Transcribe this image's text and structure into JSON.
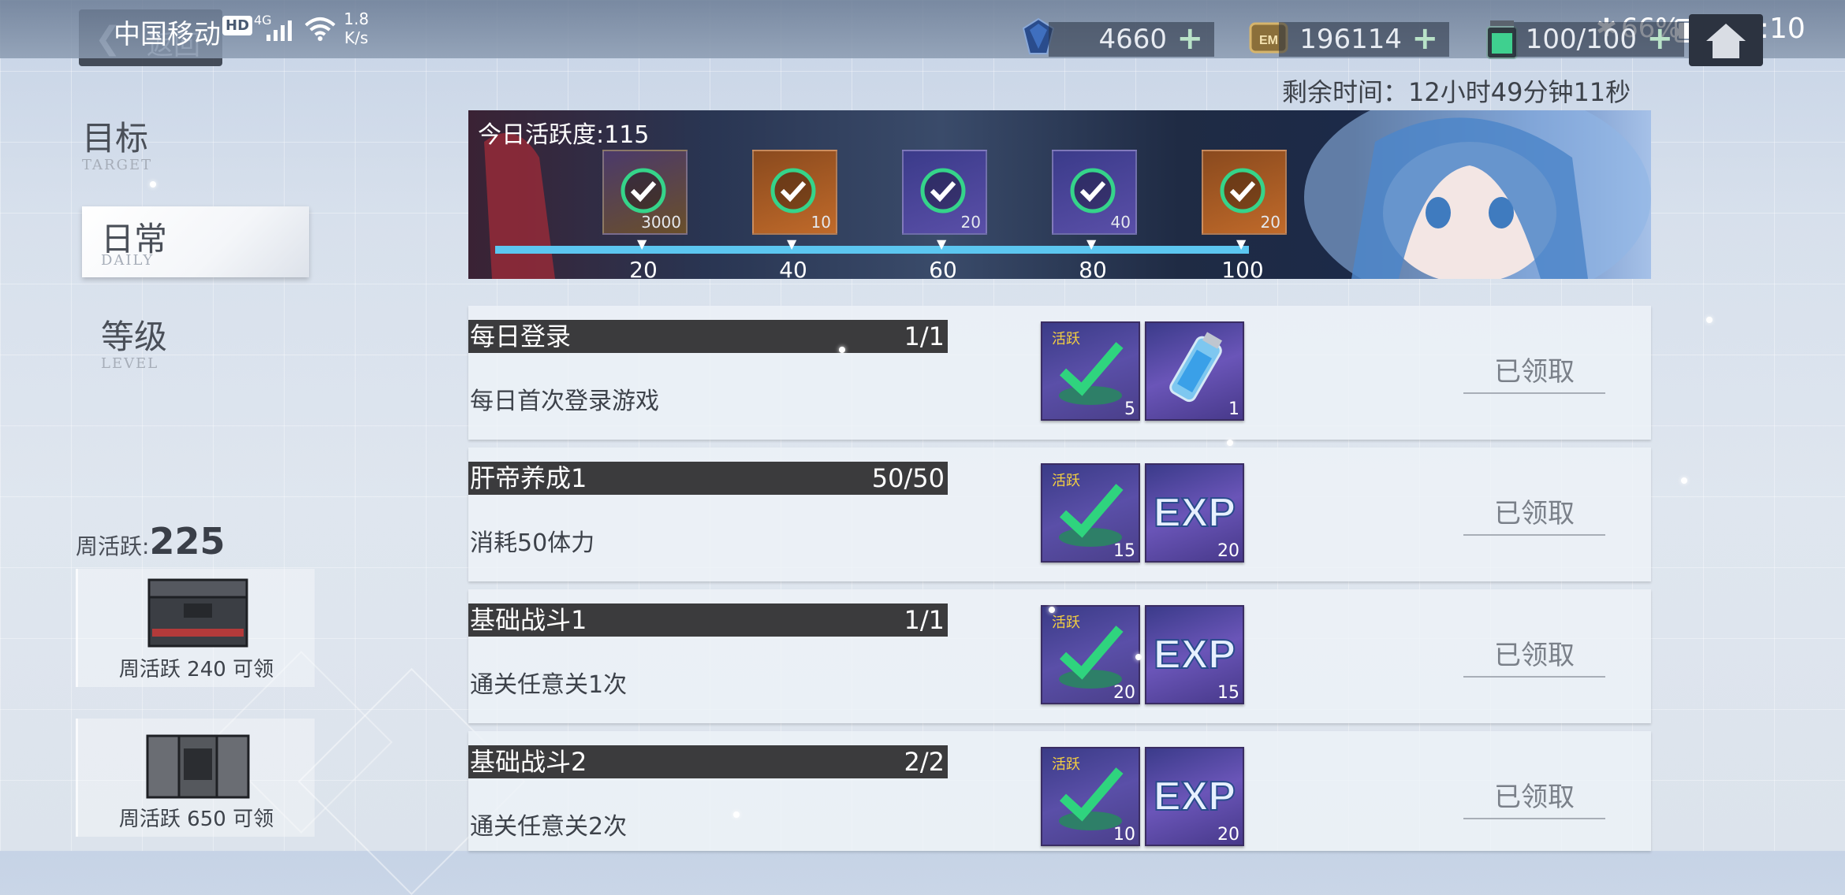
{
  "status_bar": {
    "carrier": "中国移动",
    "hd": "HD",
    "network": "4G",
    "speed_value": "1.8",
    "speed_unit": "K/s",
    "battery": "66%",
    "time": "16:10"
  },
  "header": {
    "back_label": "返回",
    "currencies": [
      {
        "icon": "diamond-icon",
        "value": "4660"
      },
      {
        "icon": "em-coin-icon",
        "value": "196114"
      },
      {
        "icon": "energy-battery-icon",
        "value": "100/100"
      }
    ]
  },
  "timer": "剩余时间：12小时49分钟11秒",
  "nav": {
    "items": [
      {
        "cn": "目标",
        "en": "TARGET"
      },
      {
        "cn": "日常",
        "en": "DAILY"
      },
      {
        "cn": "等级",
        "en": "LEVEL"
      }
    ]
  },
  "weekly": {
    "label": "周活跃:",
    "value": "225",
    "chests": [
      {
        "caption": "周活跃 240 可领"
      },
      {
        "caption": "周活跃 650 可领"
      }
    ]
  },
  "banner": {
    "title": "今日活跃度:115",
    "progress_fraction": 1.0,
    "milestones": [
      {
        "count": "3000",
        "tick": "20",
        "icon": "coin-crate-icon"
      },
      {
        "count": "10",
        "tick": "40",
        "icon": "gift-box-icon"
      },
      {
        "count": "20",
        "tick": "60",
        "icon": "canister-icon"
      },
      {
        "count": "40",
        "tick": "80",
        "icon": "canister-icon"
      },
      {
        "count": "20",
        "tick": "100",
        "icon": "gem-crate-icon"
      }
    ]
  },
  "tasks": [
    {
      "name": "每日登录",
      "progress": "1/1",
      "desc": "每日首次登录游戏",
      "rewards": [
        {
          "icon": "activity-icon",
          "count": "5"
        },
        {
          "icon": "energy-canister-icon",
          "count": "1"
        }
      ],
      "status": "已领取"
    },
    {
      "name": "肝帝养成1",
      "progress": "50/50",
      "desc": "消耗50体力",
      "rewards": [
        {
          "icon": "activity-icon",
          "count": "15"
        },
        {
          "icon": "exp-icon",
          "count": "20"
        }
      ],
      "status": "已领取"
    },
    {
      "name": "基础战斗1",
      "progress": "1/1",
      "desc": "通关任意关1次",
      "rewards": [
        {
          "icon": "activity-icon",
          "count": "20"
        },
        {
          "icon": "exp-icon",
          "count": "15"
        }
      ],
      "status": "已领取"
    },
    {
      "name": "基础战斗2",
      "progress": "2/2",
      "desc": "通关任意关2次",
      "rewards": [
        {
          "icon": "activity-icon",
          "count": "10"
        },
        {
          "icon": "exp-icon",
          "count": "20"
        }
      ],
      "status": "已领取"
    }
  ],
  "reward_label": "活跃",
  "exp_label": "EXP"
}
